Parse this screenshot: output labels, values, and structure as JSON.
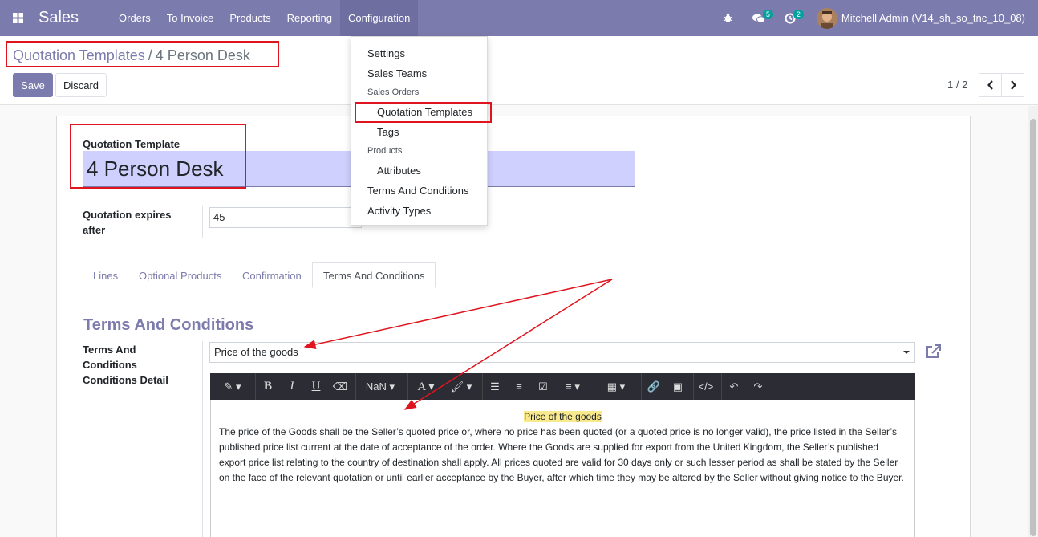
{
  "navbar": {
    "brand": "Sales",
    "menu": [
      "Orders",
      "To Invoice",
      "Products",
      "Reporting",
      "Configuration"
    ],
    "chat_count": "5",
    "activity_count": "2",
    "user_name": "Mitchell Admin (V14_sh_so_tnc_10_08)"
  },
  "breadcrumb": {
    "parent": "Quotation Templates",
    "separator": "/",
    "current": "4 Person Desk"
  },
  "buttons": {
    "save": "Save",
    "discard": "Discard"
  },
  "pager": {
    "value": "1 / 2"
  },
  "form": {
    "title_label": "Quotation Template",
    "title_value": "4 Person Desk",
    "expires_label_1": "Quotation expires",
    "expires_label_2": "after",
    "expires_value": "45",
    "tabs": [
      "Lines",
      "Optional Products",
      "Confirmation",
      "Terms And Conditions"
    ],
    "section_title": "Terms And Conditions",
    "tc_label_1": "Terms And",
    "tc_label_2": "Conditions",
    "tc_detail_label": "Conditions Detail",
    "tc_select_value": "Price of the goods",
    "editor_font_size": "NaN",
    "editor_heading": "Price of the goods",
    "editor_body": "The price of the Goods shall be the Seller’s quoted price or, where no price has been quoted (or a quoted price is no longer valid), the price listed in the Seller’s published price list current at the date of acceptance of the order. Where the Goods are supplied for export from the United Kingdom, the Seller’s published export price list relating to the country of destination shall apply. All prices quoted are valid for 30 days only or such lesser period as shall be stated by the Seller on the face of the relevant quotation or until earlier acceptance by the Buyer, after which time they may be altered by the Seller without giving notice to the Buyer."
  },
  "config_menu": {
    "settings": "Settings",
    "sales_teams": "Sales Teams",
    "sales_orders_header": "Sales Orders",
    "quotation_templates": "Quotation Templates",
    "tags": "Tags",
    "products_header": "Products",
    "attributes": "Attributes",
    "terms_and_conditions": "Terms And Conditions",
    "activity_types": "Activity Types"
  },
  "colors": {
    "brand": "#7c7bad",
    "annotation": "#e0141e",
    "highlight": "#f8e98c"
  }
}
